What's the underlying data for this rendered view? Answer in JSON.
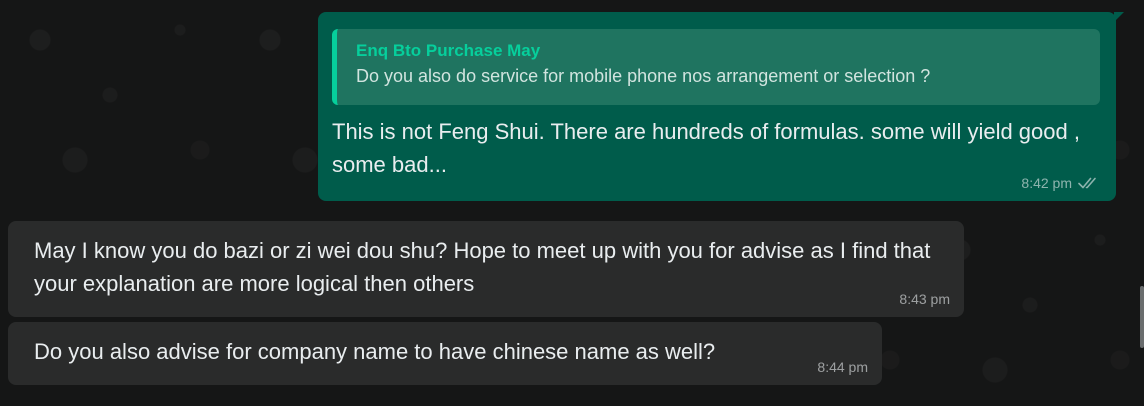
{
  "messages": [
    {
      "direction": "outgoing",
      "reply_to": {
        "author": "Enq Bto Purchase May",
        "text": "Do you also do service for mobile phone nos arrangement or selection ?"
      },
      "text": "This is not Feng Shui. There are hundreds of formulas. some will yield good , some bad...",
      "time": "8:42 pm",
      "status_icon": "double-check-icon"
    },
    {
      "direction": "incoming",
      "text": "May I know you do bazi or zi wei dou shu? Hope to meet up with you for advise as I find that your explanation are more logical then others",
      "time": "8:43 pm"
    },
    {
      "direction": "incoming",
      "text": "Do you also advise for company name to have chinese name as well?",
      "time": "8:44 pm"
    }
  ],
  "colors": {
    "outgoing_bubble": "#005c4b",
    "incoming_bubble": "#2a2b2b",
    "quote_accent": "#06cf9c",
    "background": "#151616"
  }
}
